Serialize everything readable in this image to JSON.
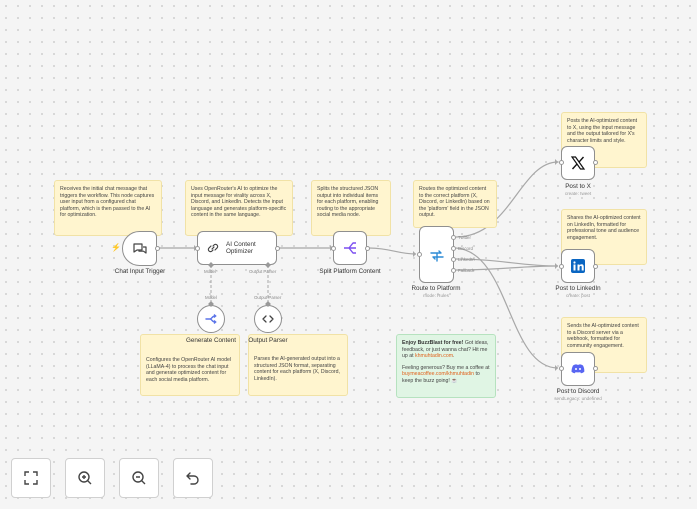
{
  "notes": {
    "trigger": "Receives the initial chat message that triggers the workflow. This node captures user input from a configured chat platform, which is then passed to the AI for optimization.",
    "optimizer": "Uses OpenRouter's AI to optimize the input message for virality across X, Discord, and LinkedIn. Detects the input language and generates platform-specific content in the same language.",
    "split": "Splits the structured JSON output into individual items for each platform, enabling routing to the appropriate social media node.",
    "route": "Routes the optimized content to the correct platform (X, Discord, or LinkedIn) based on the 'platform' field in the JSON output.",
    "x": "Posts the AI-optimized content to X, using the input message and the output tailored for X's character limits and style.",
    "linkedin": "Shares the AI-optimized content on LinkedIn, formatted for professional tone and audience engagement.",
    "discord": "Sends the AI-optimized content to a Discord server via a webhook, formatted for community engagement.",
    "generate": "Configures the OpenRouter AI model (LLaMA-4) to process the chat input and generate optimized content for each social media platform.",
    "parser": "Parses the AI-generated output into a structured JSON format, separating content for each platform (X, Discord, LinkedIn)."
  },
  "promo": {
    "line1_strong": "Enjoy BuzzBlast for free!",
    "line1_rest": " Got ideas, feedback, or just wanna chat? Hit me up at ",
    "line1_link": "khmuhtadin.com",
    "line1_end": ".",
    "line2_start": "Feeling generous? Buy me a coffee at ",
    "line2_link": "buymeacoffee.com/khmuhtadin",
    "line2_end": " to keep the buzz going! ☕"
  },
  "nodes": {
    "trigger": {
      "label": "Chat Input Trigger"
    },
    "optimizer": {
      "label": "AI Content Optimizer",
      "port_model": "Model*",
      "port_parser": "Output Parser"
    },
    "split": {
      "label": "Split Platform Content"
    },
    "route": {
      "label": "Route to Platform",
      "sub": "mode: Rules",
      "outputs": [
        "Twitter",
        "Discord",
        "LinkedIn",
        "Fallback"
      ]
    },
    "post_x": {
      "label": "Post to X",
      "sub": "create: tweet"
    },
    "post_linkedin": {
      "label": "Post to LinkedIn",
      "sub": "create: post"
    },
    "post_discord": {
      "label": "Post to Discord",
      "sub": "sendLegacy: undefined"
    },
    "generate": {
      "label": "Generate Content",
      "edge_label": "Model"
    },
    "parser": {
      "label": "Output Parser",
      "edge_label": "Output Parser"
    }
  },
  "controls": [
    "fit-view",
    "zoom-in",
    "zoom-out",
    "undo"
  ],
  "colors": {
    "canvas": "#f5f5f5",
    "sticky": "#fff5cf",
    "sticky_green": "#e0f5e4",
    "accent": "#ff6d5a",
    "split_icon": "#7b4ef0",
    "route_icon": "#2d8bd5",
    "linkedin": "#0a66c2",
    "discord": "#5865f2"
  }
}
